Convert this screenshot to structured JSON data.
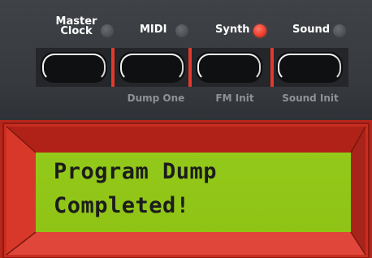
{
  "top_labels": {
    "master_clock_line1": "Master",
    "master_clock_line2": "Clock",
    "midi": "MIDI",
    "synth": "Synth",
    "sound": "Sound"
  },
  "leds": {
    "master_clock": "off",
    "midi": "off",
    "synth": "on",
    "sound": "off"
  },
  "bottom_labels": {
    "dump_one": "Dump One",
    "fm_init": "FM Init",
    "sound_init": "Sound Init"
  },
  "display": {
    "line1": "Program Dump",
    "line2": "Completed!"
  },
  "colors": {
    "panel": "#36393d",
    "accent_red": "#e4382c",
    "led_on": "#f03a2a",
    "lcd": "#8fc416",
    "frame_red": "#c72b1f"
  }
}
